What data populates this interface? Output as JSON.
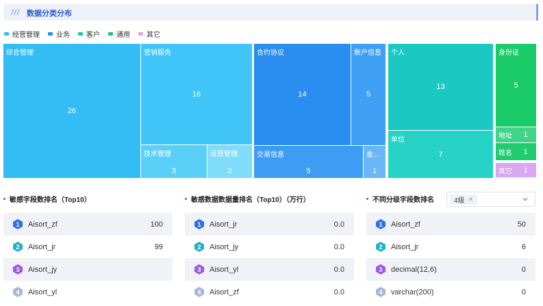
{
  "header": {
    "title": "数据分类分布"
  },
  "legend": [
    {
      "label": "经营管理",
      "color": "#33bdf5"
    },
    {
      "label": "业务",
      "color": "#2a8df0"
    },
    {
      "label": "客户",
      "color": "#1cc9c2"
    },
    {
      "label": "通用",
      "color": "#1acb6a"
    },
    {
      "label": "其它",
      "color": "#d9a8f0"
    }
  ],
  "treemap": {
    "tiles": [
      {
        "label": "综合管理",
        "value": "26"
      },
      {
        "label": "营销服务",
        "value": "16"
      },
      {
        "label": "技术管理",
        "value": "3"
      },
      {
        "label": "运营管理",
        "value": "2"
      },
      {
        "label": "合约协议",
        "value": "14"
      },
      {
        "label": "账户信息",
        "value": "5"
      },
      {
        "label": "交易信息",
        "value": "5"
      },
      {
        "label": "金...",
        "value": "1"
      },
      {
        "label": "个人",
        "value": "13"
      },
      {
        "label": "单位",
        "value": "7"
      },
      {
        "label": "身份证",
        "value": "5"
      },
      {
        "label": "地址",
        "value": "1"
      },
      {
        "label": "姓名",
        "value": "1"
      },
      {
        "label": "其它",
        "value": "1"
      }
    ]
  },
  "panels": [
    {
      "title": "敏感字段数排名（Top10）",
      "rows": [
        {
          "rank": "1",
          "name": "Aisort_zf",
          "value": "100"
        },
        {
          "rank": "2",
          "name": "Aisort_jr",
          "value": "99"
        },
        {
          "rank": "3",
          "name": "Aisort_jy",
          "value": ""
        },
        {
          "rank": "4",
          "name": "Aisort_yl",
          "value": ""
        }
      ]
    },
    {
      "title": "敏感数据数据量排名（Top10）（万行）",
      "rows": [
        {
          "rank": "1",
          "name": "Aisort_jr",
          "value": "0.0"
        },
        {
          "rank": "2",
          "name": "Aisort_jy",
          "value": "0.0"
        },
        {
          "rank": "3",
          "name": "Aisort_yl",
          "value": "0.0"
        },
        {
          "rank": "4",
          "name": "Aisort_zf",
          "value": "0.0"
        }
      ]
    },
    {
      "title": "不同分级字段数排名",
      "rows": [
        {
          "rank": "1",
          "name": "Aisort_zf",
          "value": "50"
        },
        {
          "rank": "2",
          "name": "Aisort_jr",
          "value": "6"
        },
        {
          "rank": "3",
          "name": "decimal(12,6)",
          "value": "0"
        },
        {
          "rank": "4",
          "name": "varchar(200)",
          "value": "0"
        }
      ]
    }
  ],
  "level_select": {
    "selected": "4级"
  },
  "rank_colors": [
    "#2f6fe8",
    "#23b3c6",
    "#9b59e8",
    "#a9b6d6"
  ]
}
